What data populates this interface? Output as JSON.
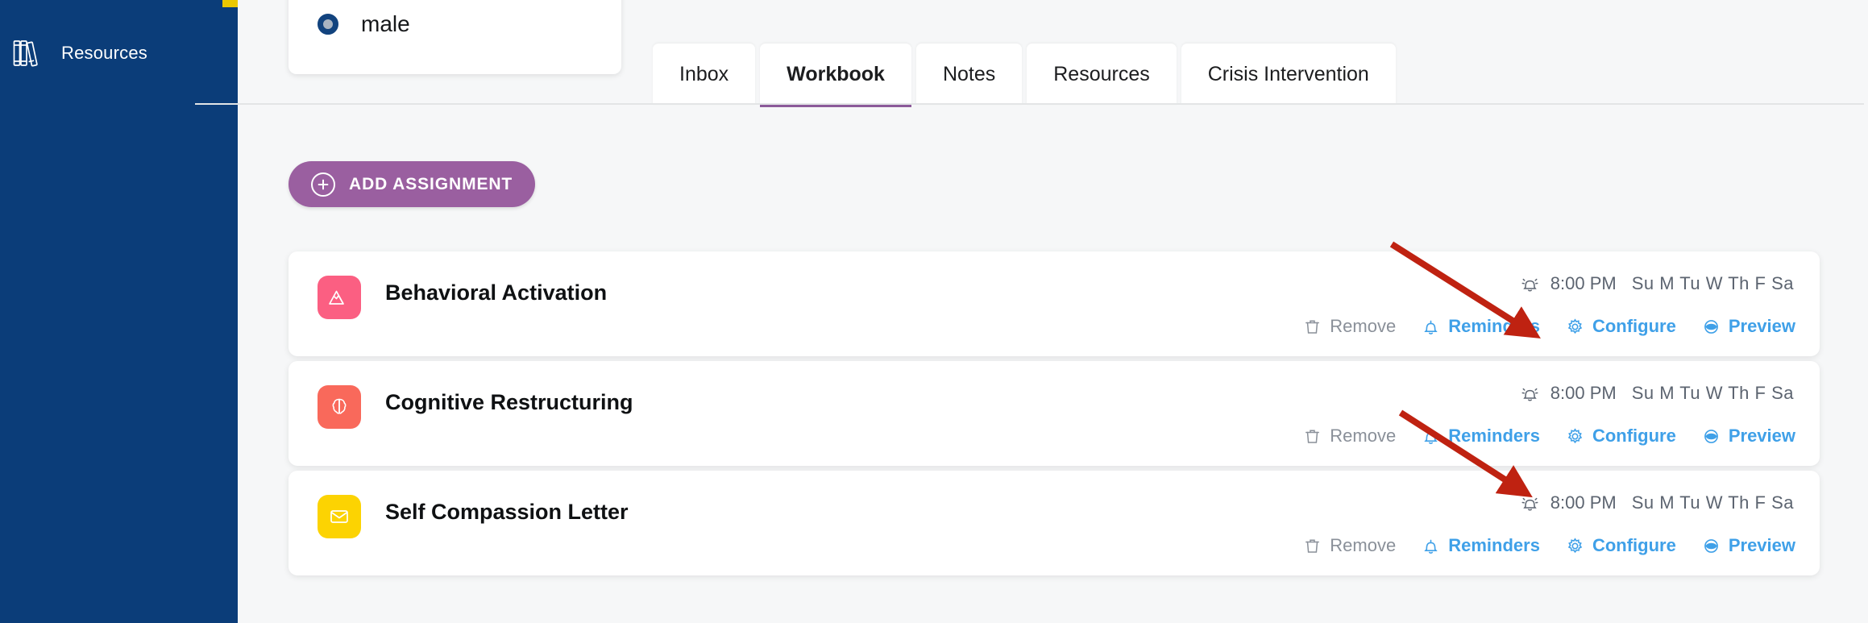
{
  "colors": {
    "sidebar_bg": "#0B3D79",
    "sidebar_accent": "#ECC800",
    "tab_active_underline": "#8C5A99",
    "primary_button": "#9A5FA0",
    "link_blue": "#3FA0E8",
    "muted_gray": "#8A9099",
    "annotation_red": "#BF2211",
    "page_bg": "#F6F7F8"
  },
  "sidebar": {
    "items": [
      {
        "label": "Resources",
        "icon": "books-icon"
      }
    ]
  },
  "gender_card": {
    "radio": {
      "label": "male",
      "selected": true
    }
  },
  "tabs": [
    {
      "label": "Inbox",
      "active": false
    },
    {
      "label": "Workbook",
      "active": true
    },
    {
      "label": "Notes",
      "active": false
    },
    {
      "label": "Resources",
      "active": false
    },
    {
      "label": "Crisis Intervention",
      "active": false
    }
  ],
  "toolbar": {
    "add_assignment_label": "ADD ASSIGNMENT",
    "add_icon": "plus-circle-icon"
  },
  "assignment_actions": [
    {
      "key": "remove",
      "label": "Remove",
      "icon": "trash-icon",
      "style": "muted"
    },
    {
      "key": "reminders",
      "label": "Reminders",
      "icon": "bell-icon",
      "style": "link"
    },
    {
      "key": "configure",
      "label": "Configure",
      "icon": "gear-icon",
      "style": "link"
    },
    {
      "key": "preview",
      "label": "Preview",
      "icon": "eye-icon",
      "style": "link"
    }
  ],
  "assignments": [
    {
      "title": "Behavioral Activation",
      "icon": "mountain-icon",
      "icon_color": "#FB5F82",
      "reminder_icon": "alarm-bell-icon",
      "time": "8:00 PM",
      "days": "Su M Tu W Th F Sa"
    },
    {
      "title": "Cognitive Restructuring",
      "icon": "brain-icon",
      "icon_color": "#F9695B",
      "reminder_icon": "alarm-bell-icon",
      "time": "8:00 PM",
      "days": "Su M Tu W Th F Sa"
    },
    {
      "title": "Self Compassion Letter",
      "icon": "letter-icon",
      "icon_color": "#FCD302",
      "reminder_icon": "alarm-bell-icon",
      "time": "8:00 PM",
      "days": "Su M Tu W Th F Sa"
    }
  ],
  "annotations": [
    {
      "name": "arrow-to-configure-1",
      "target": "configure"
    },
    {
      "name": "arrow-to-configure-2",
      "target": "configure"
    }
  ]
}
